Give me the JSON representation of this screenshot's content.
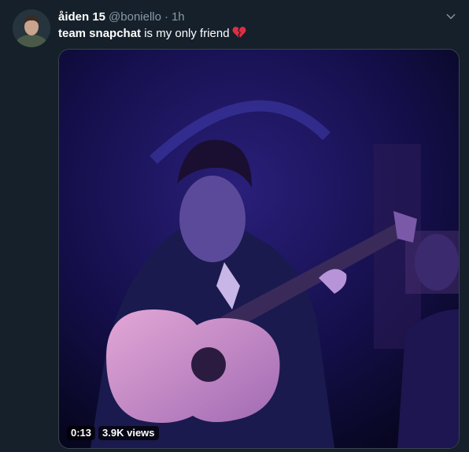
{
  "tweet": {
    "display_name": "åiden 15",
    "handle": "@boniello",
    "separator": "·",
    "time": "1h",
    "text_bold": "team snapchat",
    "text_rest": " is my only friend",
    "emoji_icon": "broken-heart-icon",
    "more_icon": "chevron-down-icon"
  },
  "media": {
    "duration": "0:13",
    "views": "3.9K views"
  },
  "colors": {
    "background": "#15202b",
    "secondary_text": "#8899a6",
    "border": "#38444d"
  }
}
